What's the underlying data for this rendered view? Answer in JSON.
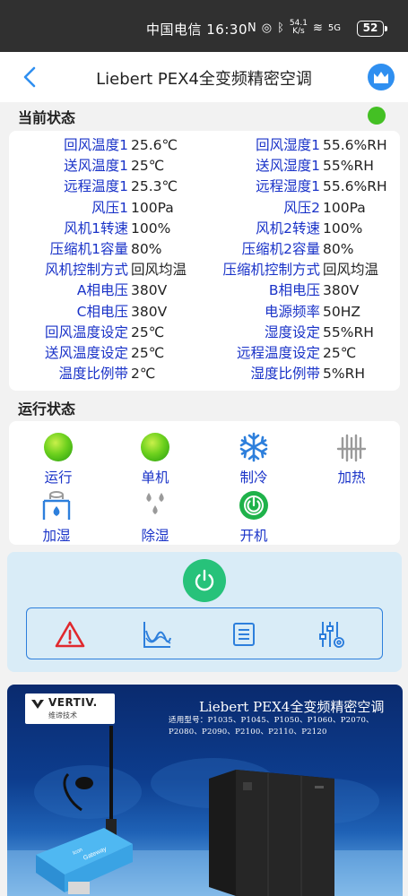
{
  "statusbar": {
    "carrier_time": "中国电信 16:30",
    "net_speed_top": "54.1",
    "net_speed_unit": "K/s",
    "signal": "5G",
    "battery": "52"
  },
  "header": {
    "title": "Liebert PEX4全变频精密空调"
  },
  "current_status": {
    "section_title": "当前状态",
    "status_color": "#44c024",
    "rows": [
      {
        "l1": "回风温度1",
        "v1": "25.6℃",
        "l2": "回风湿度1",
        "v2": "55.6%RH"
      },
      {
        "l1": "送风温度1",
        "v1": "25℃",
        "l2": "送风湿度1",
        "v2": "55%RH"
      },
      {
        "l1": "远程温度1",
        "v1": "25.3℃",
        "l2": "远程湿度1",
        "v2": "55.6%RH"
      },
      {
        "l1": "风压1",
        "v1": "100Pa",
        "l2": "风压2",
        "v2": "100Pa"
      },
      {
        "l1": "风机1转速",
        "v1": "100%",
        "l2": "风机2转速",
        "v2": "100%"
      },
      {
        "l1": "压缩机1容量",
        "v1": "80%",
        "l2": "压缩机2容量",
        "v2": "80%"
      },
      {
        "l1": "风机控制方式",
        "v1": "回风均温",
        "l2": "压缩机控制方式",
        "v2": "回风均温"
      },
      {
        "l1": "A相电压",
        "v1": "380V",
        "l2": "B相电压",
        "v2": "380V"
      },
      {
        "l1": "C相电压",
        "v1": "380V",
        "l2": "电源频率",
        "v2": "50HZ"
      },
      {
        "l1": "回风温度设定",
        "v1": "25℃",
        "l2": "湿度设定",
        "v2": "55%RH"
      },
      {
        "l1": "送风温度设定",
        "v1": "25℃",
        "l2": "远程温度设定",
        "v2": "25℃"
      },
      {
        "l1": "温度比例带",
        "v1": "2℃",
        "l2": "湿度比例带",
        "v2": "5%RH"
      }
    ]
  },
  "run_status": {
    "section_title": "运行状态",
    "items": [
      {
        "label": "运行",
        "icon": "green-ball-icon"
      },
      {
        "label": "单机",
        "icon": "green-ball-icon"
      },
      {
        "label": "制冷",
        "icon": "snowflake-icon"
      },
      {
        "label": "加热",
        "icon": "heater-icon"
      },
      {
        "label": "加湿",
        "icon": "humidifier-icon"
      },
      {
        "label": "除湿",
        "icon": "droplets-icon"
      },
      {
        "label": "开机",
        "icon": "power-on-icon"
      }
    ]
  },
  "controls": {
    "power_icon": "power-icon",
    "tools": [
      "alarm-icon",
      "trend-chart-icon",
      "log-list-icon",
      "settings-sliders-icon"
    ]
  },
  "banner": {
    "brand": "VERTIV.",
    "brand_sub": "维谛技术",
    "title": "Liebert PEX4全变频精密空调",
    "models": "适用型号：P1035、P1045、P1050、P1060、P2070、P2080、P2090、P2100、P2110、P2120",
    "device_label": "Gateway",
    "device_brand": "Icon"
  },
  "colors": {
    "label_blue": "#1a33c8",
    "accent_blue": "#2f8ff0",
    "power_green": "#27c27a",
    "alarm_red": "#e0282e"
  }
}
